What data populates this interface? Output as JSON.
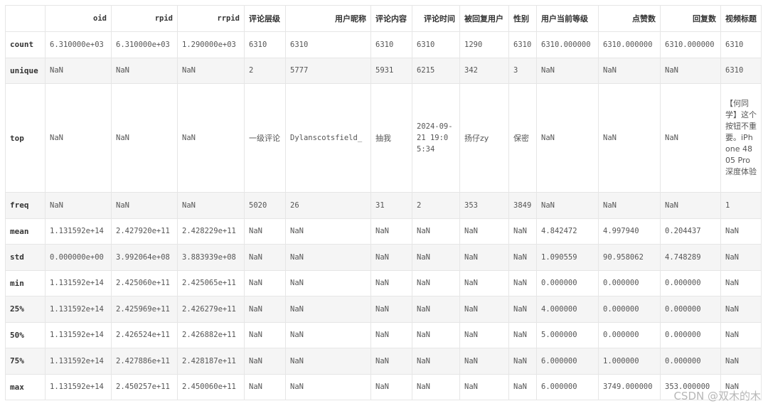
{
  "columns": [
    "",
    "oid",
    "rpid",
    "rrpid",
    "评论层级",
    "用户昵称",
    "评论内容",
    "评论时间",
    "被回复用户",
    "性别",
    "用户当前等级",
    "点赞数",
    "回复数",
    "视频标题"
  ],
  "rows": [
    {
      "label": "count",
      "cells": [
        "6.310000e+03",
        "6.310000e+03",
        "1.290000e+03",
        "6310",
        "6310",
        "6310",
        "6310",
        "1290",
        "6310",
        "6310.000000",
        "6310.000000",
        "6310.000000",
        "6310"
      ]
    },
    {
      "label": "unique",
      "cells": [
        "NaN",
        "NaN",
        "NaN",
        "2",
        "5777",
        "5931",
        "6215",
        "342",
        "3",
        "NaN",
        "NaN",
        "NaN",
        "6310"
      ]
    },
    {
      "label": "top",
      "cells": [
        "NaN",
        "NaN",
        "NaN",
        "一级评论",
        "Dylanscotsfield_",
        "抽我",
        "2024-09-21 19:05:34",
        "扬仔zy",
        "保密",
        "NaN",
        "NaN",
        "NaN",
        "【何同学】这个按钮不重要。iPhone 4805 Pro深度体验"
      ]
    },
    {
      "label": "freq",
      "cells": [
        "NaN",
        "NaN",
        "NaN",
        "5020",
        "26",
        "31",
        "2",
        "353",
        "3849",
        "NaN",
        "NaN",
        "NaN",
        "1"
      ]
    },
    {
      "label": "mean",
      "cells": [
        "1.131592e+14",
        "2.427920e+11",
        "2.428229e+11",
        "NaN",
        "NaN",
        "NaN",
        "NaN",
        "NaN",
        "NaN",
        "4.842472",
        "4.997940",
        "0.204437",
        "NaN"
      ]
    },
    {
      "label": "std",
      "cells": [
        "0.000000e+00",
        "3.992064e+08",
        "3.883939e+08",
        "NaN",
        "NaN",
        "NaN",
        "NaN",
        "NaN",
        "NaN",
        "1.090559",
        "90.958062",
        "4.748289",
        "NaN"
      ]
    },
    {
      "label": "min",
      "cells": [
        "1.131592e+14",
        "2.425060e+11",
        "2.425065e+11",
        "NaN",
        "NaN",
        "NaN",
        "NaN",
        "NaN",
        "NaN",
        "0.000000",
        "0.000000",
        "0.000000",
        "NaN"
      ]
    },
    {
      "label": "25%",
      "cells": [
        "1.131592e+14",
        "2.425969e+11",
        "2.426279e+11",
        "NaN",
        "NaN",
        "NaN",
        "NaN",
        "NaN",
        "NaN",
        "4.000000",
        "0.000000",
        "0.000000",
        "NaN"
      ]
    },
    {
      "label": "50%",
      "cells": [
        "1.131592e+14",
        "2.426524e+11",
        "2.426882e+11",
        "NaN",
        "NaN",
        "NaN",
        "NaN",
        "NaN",
        "NaN",
        "5.000000",
        "0.000000",
        "0.000000",
        "NaN"
      ]
    },
    {
      "label": "75%",
      "cells": [
        "1.131592e+14",
        "2.427886e+11",
        "2.428187e+11",
        "NaN",
        "NaN",
        "NaN",
        "NaN",
        "NaN",
        "NaN",
        "6.000000",
        "1.000000",
        "0.000000",
        "NaN"
      ]
    },
    {
      "label": "max",
      "cells": [
        "1.131592e+14",
        "2.450257e+11",
        "2.450060e+11",
        "NaN",
        "NaN",
        "NaN",
        "NaN",
        "NaN",
        "NaN",
        "6.000000",
        "3749.000000",
        "353.000000",
        "NaN"
      ]
    }
  ],
  "watermark": "CSDN @双木的木"
}
